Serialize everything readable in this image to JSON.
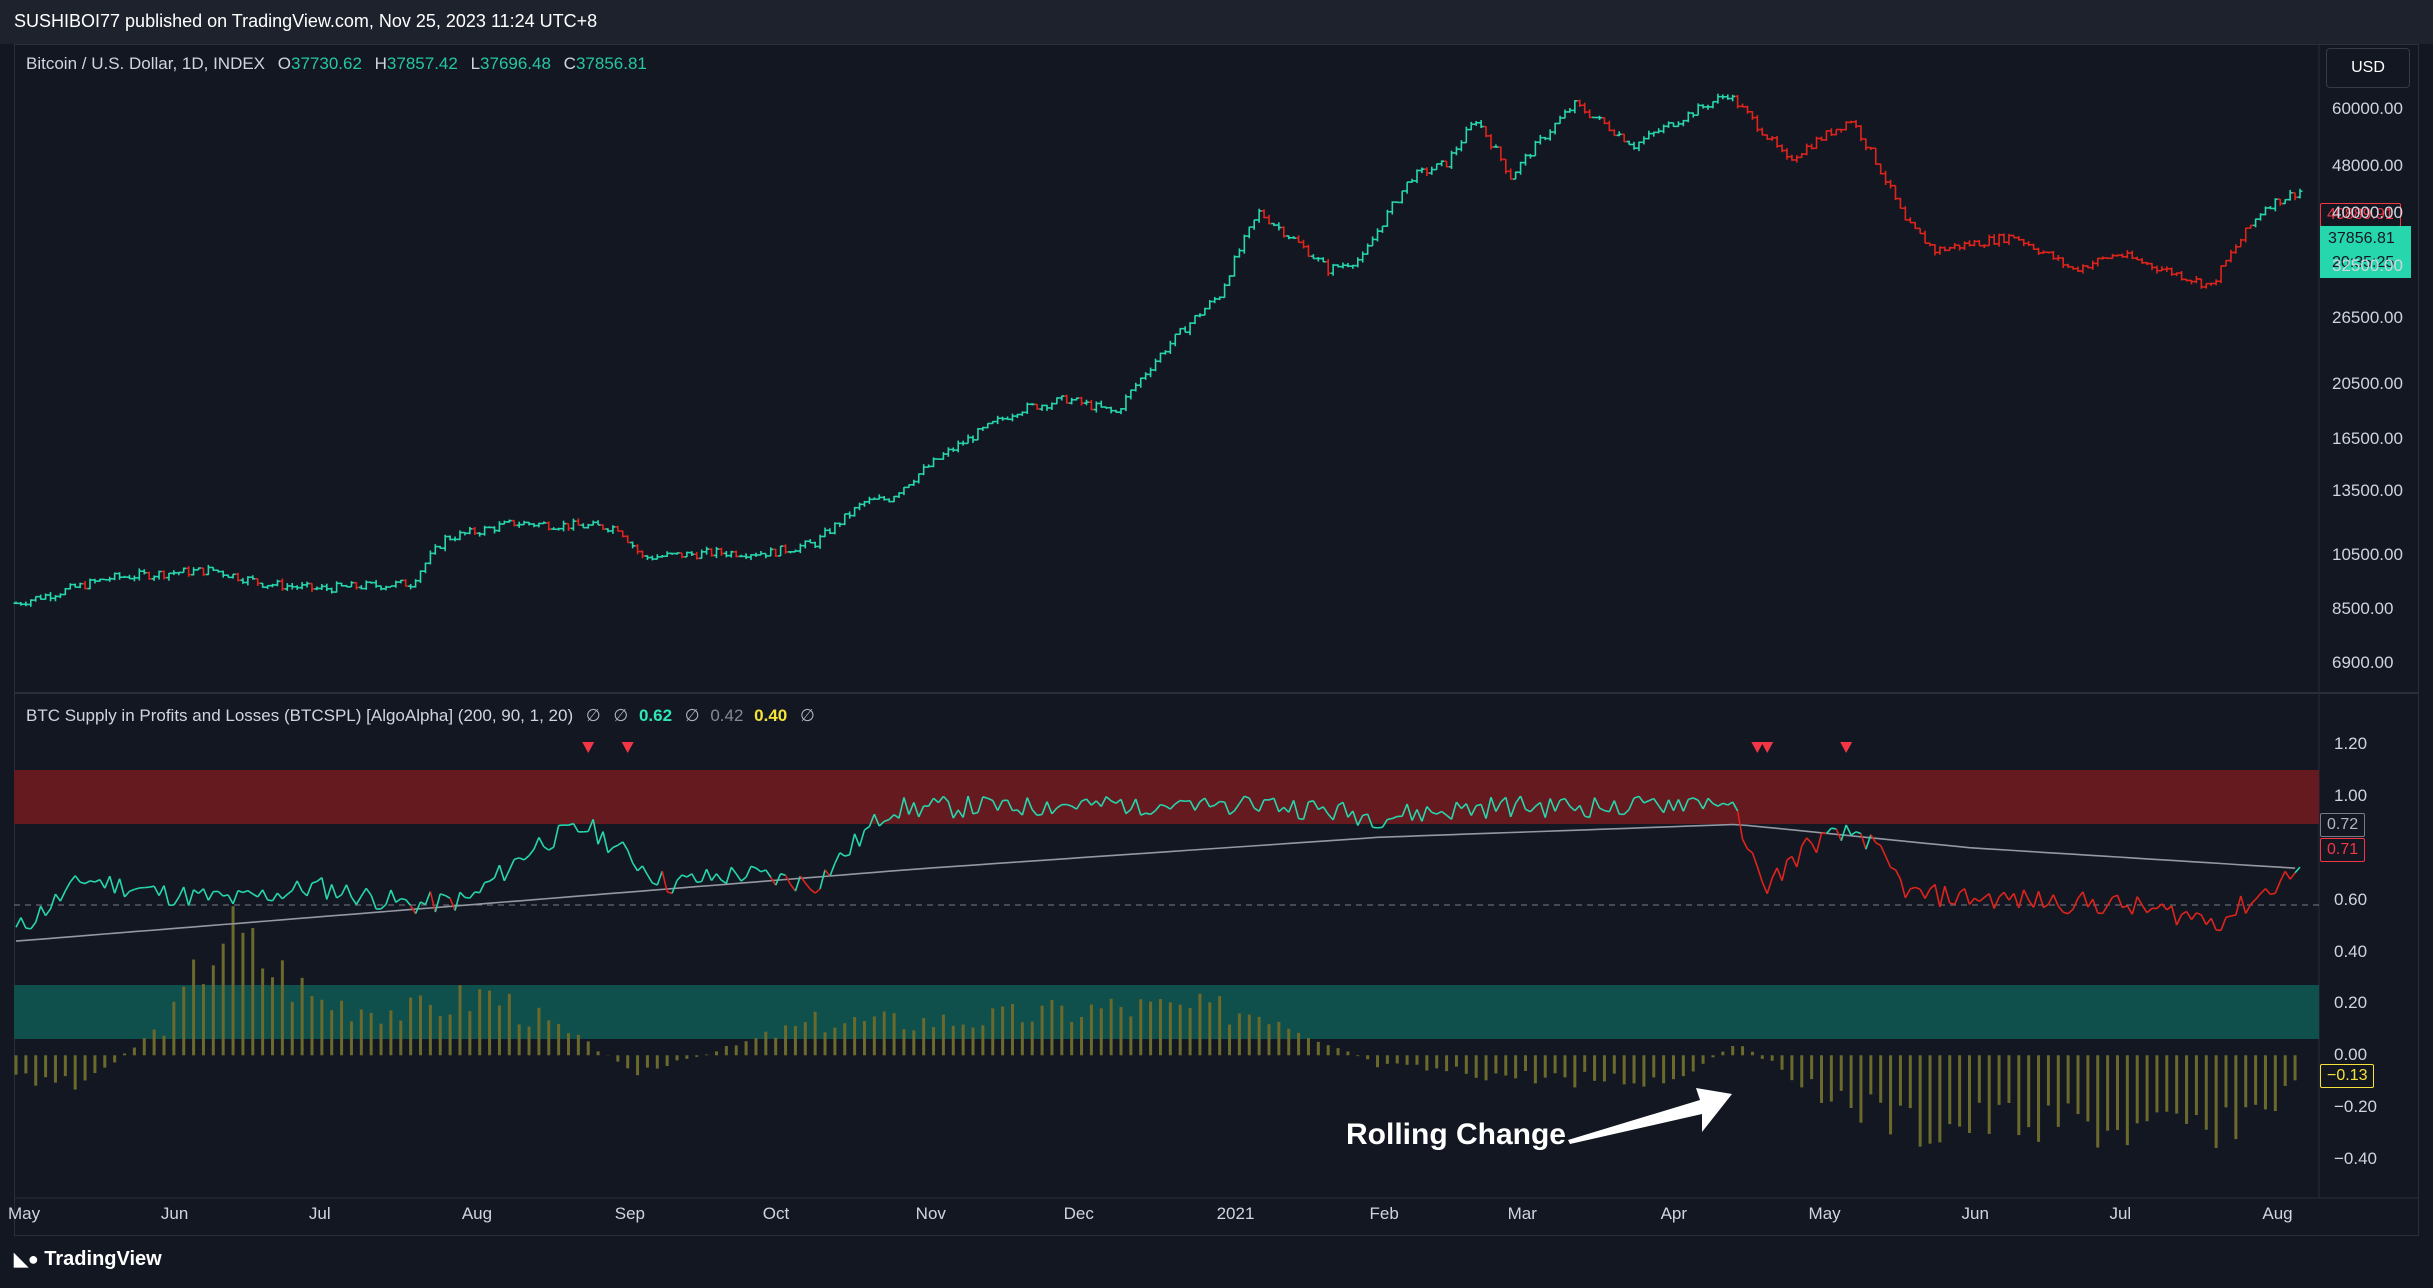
{
  "header": {
    "publish_text": "SUSHIBOI77 published on TradingView.com, Nov 25, 2023 11:24 UTC+8"
  },
  "price_legend": {
    "symbol": "Bitcoin / U.S. Dollar, 1D, INDEX",
    "o_label": "O",
    "o_value": "37730.62",
    "h_label": "H",
    "h_value": "37857.42",
    "l_label": "L",
    "l_value": "37696.48",
    "c_label": "C",
    "c_value": "37856.81"
  },
  "indicator_legend": {
    "name": "BTC Supply in Profits and Losses (BTCSPL) [AlgoAlpha] (200, 90, 1, 20)",
    "empty1": "∅",
    "empty2": "∅",
    "val1": "0.62",
    "empty3": "∅",
    "val2": "0.42",
    "val3": "0.40",
    "empty4": "∅"
  },
  "currency_button": "USD",
  "price_tags": {
    "red": "40889.91",
    "green_price": "37856.81",
    "green_timer": "20:35:25"
  },
  "indicator_tags": {
    "grey": "0.72",
    "red": "0.71",
    "yellow": "−0.13"
  },
  "annotation": "Rolling Change",
  "footer": {
    "brand": "TradingView"
  },
  "colors": {
    "bg": "#131722",
    "up": "#26d7ae",
    "down": "#e0241b",
    "hist": "#6b6a2c",
    "band_red": "#641a1f",
    "band_teal": "#0f4f4c"
  },
  "chart_data": [
    {
      "type": "line",
      "title": "Bitcoin / U.S. Dollar, 1D, INDEX",
      "scale": "log",
      "ylim": [
        6200,
        72000
      ],
      "y_ticks": [
        "60000.00",
        "48000.00",
        "40000.00",
        "32500.00",
        "26500.00",
        "20500.00",
        "16500.00",
        "13500.00",
        "10500.00",
        "8500.00",
        "6900.00"
      ],
      "x_ticks": [
        "May",
        "Jun",
        "Jul",
        "Aug",
        "Sep",
        "Oct",
        "Nov",
        "Dec",
        "2021",
        "Feb",
        "Mar",
        "Apr",
        "May",
        "Jun",
        "Jul",
        "Aug"
      ],
      "series": [
        {
          "name": "BTCUSD",
          "x": [
            "2020-05-01",
            "2020-05-10",
            "2020-05-20",
            "2020-06-01",
            "2020-06-10",
            "2020-06-20",
            "2020-07-01",
            "2020-07-10",
            "2020-07-20",
            "2020-07-27",
            "2020-08-10",
            "2020-08-20",
            "2020-08-31",
            "2020-09-05",
            "2020-09-20",
            "2020-10-01",
            "2020-10-10",
            "2020-10-20",
            "2020-10-25",
            "2020-11-05",
            "2020-11-20",
            "2020-11-30",
            "2020-12-10",
            "2020-12-20",
            "2020-12-31",
            "2021-01-08",
            "2021-01-15",
            "2021-01-22",
            "2021-01-29",
            "2021-02-08",
            "2021-02-15",
            "2021-02-21",
            "2021-02-28",
            "2021-03-13",
            "2021-03-25",
            "2021-04-13",
            "2021-04-25",
            "2021-05-08",
            "2021-05-19",
            "2021-05-25",
            "2021-06-10",
            "2021-06-22",
            "2021-07-01",
            "2021-07-20",
            "2021-07-31",
            "2021-08-07"
          ],
          "values": [
            8700,
            9100,
            9600,
            9800,
            9900,
            9400,
            9200,
            9300,
            9400,
            11200,
            11900,
            11800,
            11700,
            10400,
            10600,
            10600,
            11000,
            12900,
            13100,
            15500,
            18500,
            19300,
            18300,
            23500,
            29000,
            40000,
            36000,
            32000,
            33500,
            46000,
            48500,
            57500,
            46000,
            61000,
            52000,
            63500,
            49000,
            57500,
            38500,
            34500,
            36500,
            32000,
            34000,
            30000,
            41000,
            43500
          ]
        }
      ]
    },
    {
      "type": "line",
      "title": "BTC Supply in Profits and Losses (BTCSPL) [AlgoAlpha] (200, 90, 1, 20)",
      "ylim": [
        -0.5,
        1.3
      ],
      "y_ticks": [
        "1.20",
        "1.00",
        "0.60",
        "0.40",
        "0.20",
        "0.00",
        "−0.20",
        "−0.40"
      ],
      "bands": [
        {
          "from": 0.8,
          "to": 1.0,
          "color": "red"
        },
        {
          "from": 0.0,
          "to": 0.2,
          "color": "teal"
        }
      ],
      "dashed_level": 0.5,
      "signal_markers": [
        "2020-08-25",
        "2020-09-02",
        "2021-04-19",
        "2021-04-21",
        "2021-05-07"
      ],
      "series": [
        {
          "x": [
            "2020-05-01",
            "2020-05-15",
            "2020-06-01",
            "2020-06-15",
            "2020-07-01",
            "2020-07-20",
            "2020-08-01",
            "2020-08-15",
            "2020-08-25",
            "2020-09-10",
            "2020-09-25",
            "2020-10-10",
            "2020-10-25",
            "2020-11-15",
            "2020-12-10",
            "2021-01-10",
            "2021-02-01",
            "2021-02-25",
            "2021-03-20",
            "2021-04-14",
            "2021-04-20",
            "2021-04-30",
            "2021-05-10",
            "2021-05-20",
            "2021-06-10",
            "2021-07-01",
            "2021-07-22",
            "2021-08-07"
          ],
          "values": [
            0.48,
            0.68,
            0.62,
            0.6,
            0.65,
            0.58,
            0.6,
            0.82,
            0.88,
            0.66,
            0.7,
            0.66,
            0.95,
            0.96,
            0.97,
            0.97,
            0.92,
            0.96,
            0.96,
            0.99,
            0.64,
            0.82,
            0.86,
            0.62,
            0.6,
            0.58,
            0.52,
            0.72
          ]
        },
        {
          "x": [
            "2020-05-01",
            "2020-08-01",
            "2020-11-01",
            "2021-02-01",
            "2021-04-15",
            "2021-06-01",
            "2021-08-07"
          ],
          "values": [
            0.44,
            0.58,
            0.72,
            0.84,
            0.89,
            0.8,
            0.72
          ]
        },
        {
          "x": [
            "2020-05-01",
            "2020-05-15",
            "2020-06-01",
            "2020-06-12",
            "2020-07-01",
            "2020-07-20",
            "2020-08-05",
            "2020-09-05",
            "2020-10-10",
            "2020-11-10",
            "2020-12-10",
            "2021-01-10",
            "2021-02-01",
            "2021-03-01",
            "2021-04-01",
            "2021-04-15",
            "2021-05-01",
            "2021-05-20",
            "2021-06-15",
            "2021-07-10",
            "2021-07-25",
            "2021-08-07"
          ],
          "values": [
            -0.1,
            -0.12,
            0.15,
            0.58,
            0.25,
            0.2,
            0.28,
            -0.08,
            0.15,
            0.16,
            0.22,
            0.2,
            -0.05,
            -0.1,
            -0.12,
            0.05,
            -0.15,
            -0.35,
            -0.3,
            -0.38,
            -0.3,
            -0.15
          ]
        }
      ]
    }
  ]
}
